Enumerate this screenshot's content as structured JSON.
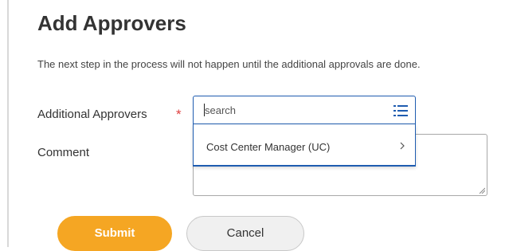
{
  "page": {
    "title": "Add Approvers",
    "description": "The next step in the process will not happen until the additional approvals are done."
  },
  "form": {
    "additional_approvers_label": "Additional Approvers",
    "required_marker": "*",
    "search_placeholder": "search",
    "search_value": "",
    "comment_label": "Comment",
    "comment_value": ""
  },
  "dropdown": {
    "items": [
      {
        "label": "Cost Center Manager (UC)",
        "icon": "chevron-right-icon"
      }
    ]
  },
  "actions": {
    "submit_label": "Submit",
    "cancel_label": "Cancel"
  },
  "colors": {
    "accent_orange": "#f5a623",
    "focus_blue": "#1e5cb0",
    "required_red": "#de4040"
  },
  "icons": {
    "search_list": "list-icon"
  }
}
